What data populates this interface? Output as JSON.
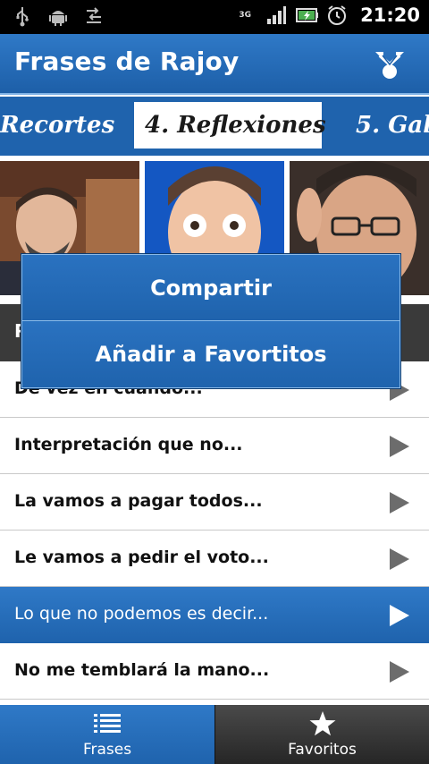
{
  "statusbar": {
    "left_icons": [
      "usb-icon",
      "android-debug-icon",
      "data-sync-icon"
    ],
    "network_type": "3G",
    "right_icons": [
      "signal-icon",
      "battery-charging-icon",
      "alarm-icon"
    ],
    "time": "21:20"
  },
  "header": {
    "title": "Frases de Rajoy",
    "share_icon": "share-icon"
  },
  "tabs": [
    {
      "label": "Recortes",
      "active": false
    },
    {
      "label": "4. Reflexiones",
      "active": true
    },
    {
      "label": "5. Gal",
      "active": false
    }
  ],
  "section": {
    "header_visible_text": "R"
  },
  "list": {
    "items": [
      {
        "label": "De vez en cuando...",
        "selected": false
      },
      {
        "label": "Interpretación que no...",
        "selected": false
      },
      {
        "label": "La vamos a pagar todos...",
        "selected": false
      },
      {
        "label": "Le vamos a pedir el voto...",
        "selected": false
      },
      {
        "label": "Lo que no podemos es decir...",
        "selected": true
      },
      {
        "label": "No me temblará la mano...",
        "selected": false
      }
    ]
  },
  "popup": {
    "items": [
      {
        "label": "Compartir"
      },
      {
        "label": "Añadir a Favortitos"
      }
    ]
  },
  "bottom_nav": {
    "items": [
      {
        "label": "Frases",
        "icon": "list-icon",
        "active": true
      },
      {
        "label": "Favoritos",
        "icon": "star-icon",
        "active": false
      }
    ]
  },
  "colors": {
    "brand_blue": "#1f63ad",
    "accent_light": "#8bbbe9",
    "status_bar": "#000000",
    "nav_inactive": "#2a2a2a"
  }
}
